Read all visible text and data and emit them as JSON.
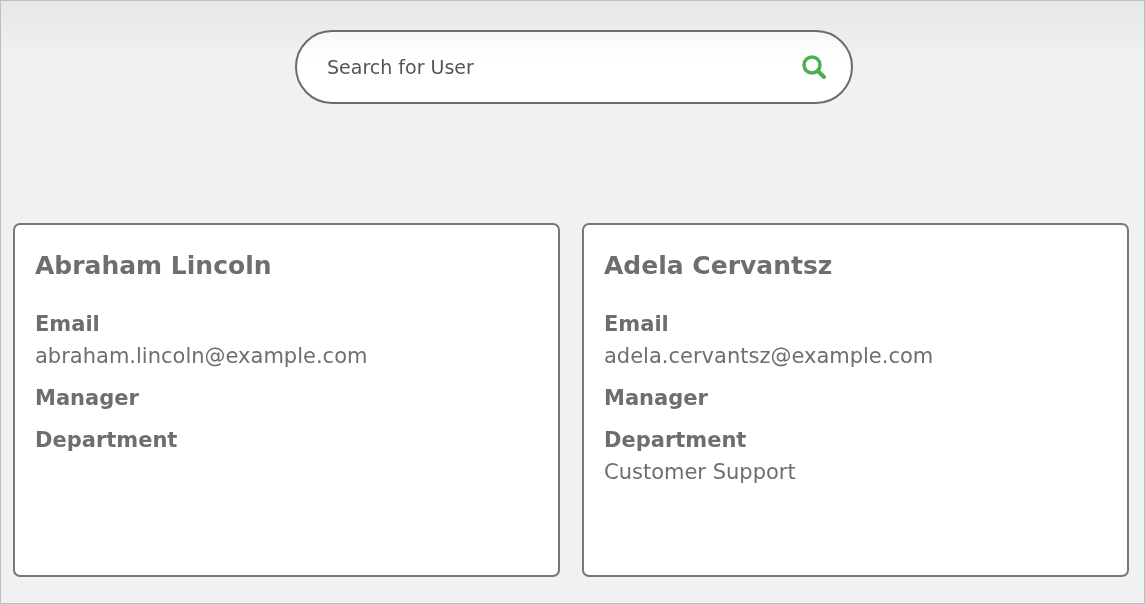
{
  "search": {
    "placeholder": "Search for User"
  },
  "users": [
    {
      "name": "Abraham Lincoln",
      "fields": [
        {
          "label": "Email",
          "value": "abraham.lincoln@example.com"
        },
        {
          "label": "Manager"
        },
        {
          "label": "Department"
        }
      ]
    },
    {
      "name": "Adela Cervantsz",
      "fields": [
        {
          "label": "Email",
          "value": "adela.cervantsz@example.com"
        },
        {
          "label": "Manager"
        },
        {
          "label": "Department",
          "value": "Customer Support"
        }
      ]
    }
  ]
}
